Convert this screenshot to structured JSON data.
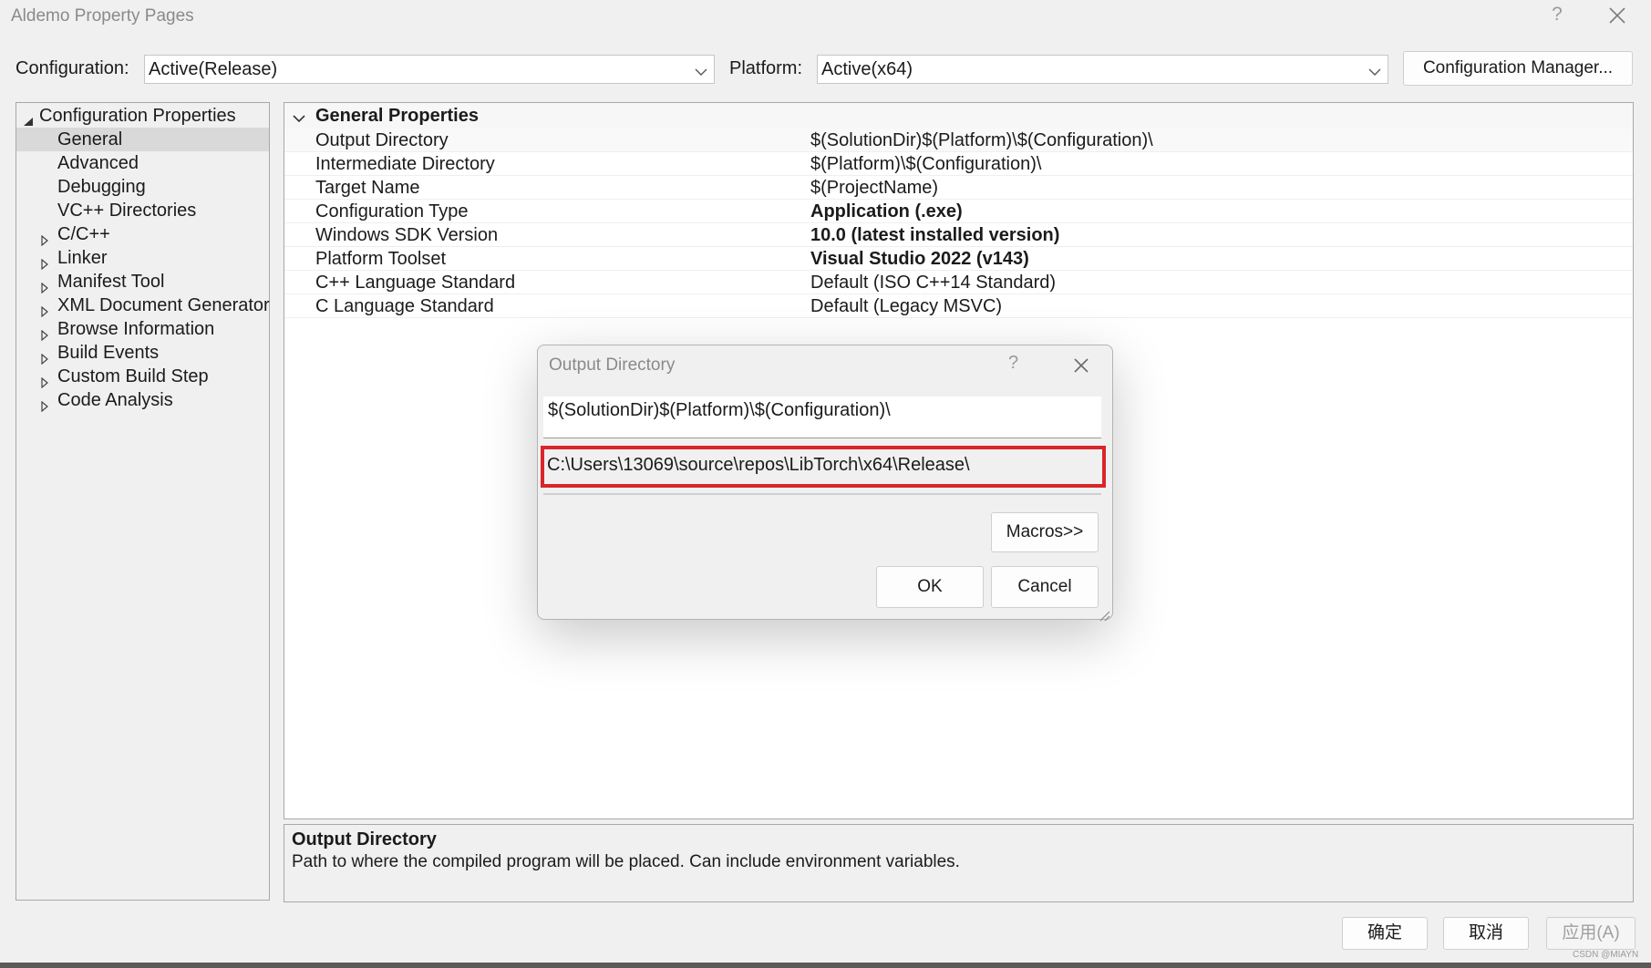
{
  "window": {
    "title": "Aldemo Property Pages",
    "help_glyph": "?",
    "close_glyph": "×"
  },
  "config": {
    "configuration_label": "Configuration:",
    "configuration_value": "Active(Release)",
    "platform_label": "Platform:",
    "platform_value": "Active(x64)",
    "manager_button": "Configuration Manager..."
  },
  "tree": {
    "root": "Configuration Properties",
    "items": [
      {
        "label": "General",
        "expandable": false,
        "selected": true
      },
      {
        "label": "Advanced",
        "expandable": false
      },
      {
        "label": "Debugging",
        "expandable": false
      },
      {
        "label": "VC++ Directories",
        "expandable": false
      },
      {
        "label": "C/C++",
        "expandable": true
      },
      {
        "label": "Linker",
        "expandable": true
      },
      {
        "label": "Manifest Tool",
        "expandable": true
      },
      {
        "label": "XML Document Generator",
        "expandable": true
      },
      {
        "label": "Browse Information",
        "expandable": true
      },
      {
        "label": "Build Events",
        "expandable": true
      },
      {
        "label": "Custom Build Step",
        "expandable": true
      },
      {
        "label": "Code Analysis",
        "expandable": true
      }
    ]
  },
  "grid": {
    "section": "General Properties",
    "rows": [
      {
        "name": "Output Directory",
        "value": "$(SolutionDir)$(Platform)\\$(Configuration)\\",
        "bold": false
      },
      {
        "name": "Intermediate Directory",
        "value": "$(Platform)\\$(Configuration)\\",
        "bold": false
      },
      {
        "name": "Target Name",
        "value": "$(ProjectName)",
        "bold": false
      },
      {
        "name": "Configuration Type",
        "value": "Application (.exe)",
        "bold": true
      },
      {
        "name": "Windows SDK Version",
        "value": "10.0 (latest installed version)",
        "bold": true
      },
      {
        "name": "Platform Toolset",
        "value": "Visual Studio 2022 (v143)",
        "bold": true
      },
      {
        "name": "C++ Language Standard",
        "value": "Default (ISO C++14 Standard)",
        "bold": false
      },
      {
        "name": "C Language Standard",
        "value": "Default (Legacy MSVC)",
        "bold": false
      }
    ]
  },
  "description": {
    "title": "Output Directory",
    "text": "Path to where the compiled program will be placed. Can include environment variables."
  },
  "buttons": {
    "ok": "确定",
    "cancel": "取消",
    "apply": "应用(A)"
  },
  "dialog": {
    "title": "Output Directory",
    "help_glyph": "?",
    "input_value": "$(SolutionDir)$(Platform)\\$(Configuration)\\",
    "evaluated_value": "C:\\Users\\13069\\source\\repos\\LibTorch\\x64\\Release\\",
    "macros_button": "Macros>>",
    "ok_button": "OK",
    "cancel_button": "Cancel",
    "highlight_color": "#d9262a"
  },
  "watermark": "CSDN @MIAYN"
}
